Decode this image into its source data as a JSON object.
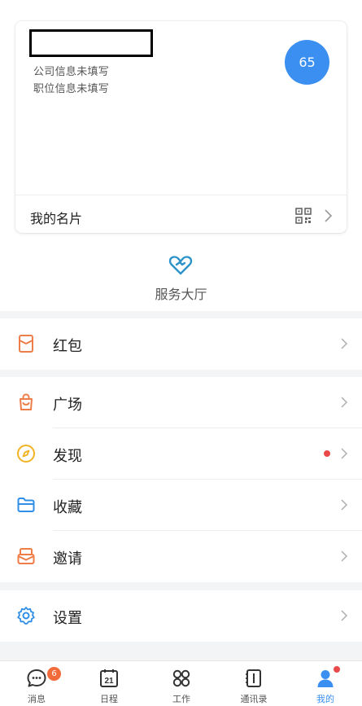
{
  "profile": {
    "company": "公司信息未填写",
    "position": "职位信息未填写",
    "avatar_text": "65",
    "card_label": "我的名片"
  },
  "service": {
    "label": "服务大厅"
  },
  "menu": {
    "hongbao": "红包",
    "guangchang": "广场",
    "faxian": "发现",
    "shoucang": "收藏",
    "yaoqing": "邀请",
    "shezhi": "设置"
  },
  "tabbar": {
    "items": [
      {
        "label": "消息",
        "badge": "6"
      },
      {
        "label": "日程",
        "icon_text": "21"
      },
      {
        "label": "工作"
      },
      {
        "label": "通讯录"
      },
      {
        "label": "我的"
      }
    ]
  },
  "colors": {
    "accent": "#3a8ff0",
    "icon_orange": "#ef7d48",
    "icon_yellow": "#f2b324",
    "icon_blue": "#2f8fe6",
    "service_teal": "#2b93c9",
    "badge_red": "#e94b4b"
  },
  "icons": {
    "hongbao": "red-envelope-icon",
    "guangchang": "shopping-bag-icon",
    "faxian": "compass-icon",
    "shoucang": "folder-icon",
    "yaoqing": "envelope-icon",
    "shezhi": "gear-icon"
  }
}
